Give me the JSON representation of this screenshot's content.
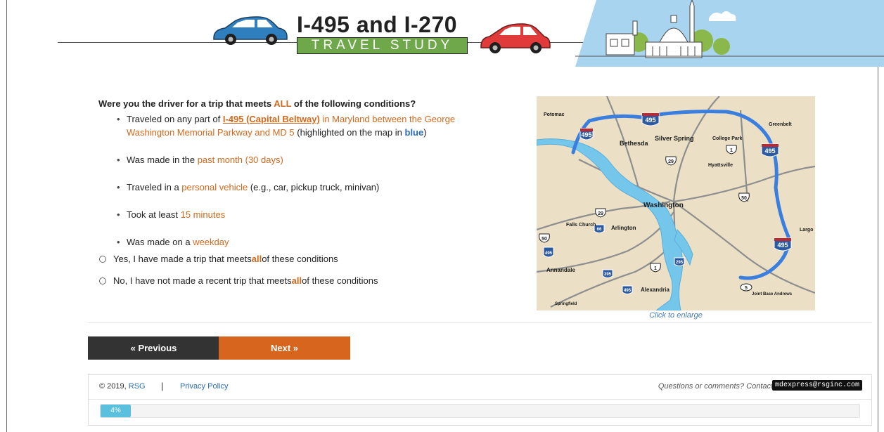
{
  "header": {
    "title": "I-495 and I-270",
    "subtitle": "TRAVEL STUDY",
    "colors": {
      "car_blue": "#2f7fbf",
      "car_red": "#e03a3a",
      "green": "#6fa84a",
      "sky": "#a9d4ef"
    }
  },
  "question": {
    "prefix": "Were you the driver for a trip that meets ",
    "emph": "ALL",
    "suffix": " of the following conditions?"
  },
  "conditions": [
    {
      "a": "Traveled on any part of ",
      "link": "I-495 (Capital Beltway)",
      "b": " in Maryland between the George Washington Memorial Parkway and MD 5",
      "c": " (highlighted on the map in ",
      "d": "blue",
      "e": ")"
    },
    {
      "a": "Was made in the ",
      "hl": "past month (30 days)"
    },
    {
      "a": "Traveled in a ",
      "hl": "personal vehicle",
      "b": " (e.g., car, pickup truck, minivan)"
    },
    {
      "a": "Took at least ",
      "hl": "15 minutes"
    },
    {
      "a": "Was made on a ",
      "hl": "weekday"
    }
  ],
  "options": [
    {
      "a": "Yes, I have made a trip that meets ",
      "hl": "all",
      "b": " of these conditions"
    },
    {
      "a": "No, I have not made a recent trip that meets ",
      "hl": "all",
      "b": " of these conditions"
    }
  ],
  "map": {
    "caption": "Click to enlarge",
    "labels": {
      "potomac": "Potomac",
      "bethesda": "Bethesda",
      "silver_spring": "Silver Spring",
      "college_park": "College Park",
      "greenbelt": "Greenbelt",
      "hyattsville": "Hyattsville",
      "washington": "Washington",
      "falls_church": "Falls Church",
      "arlington": "Arlington",
      "largo": "Largo",
      "annandale": "Annandale",
      "alexandria": "Alexandria",
      "springfield": "Springfield",
      "jba": "Joint Base Andrews"
    },
    "shields": {
      "i495": "495",
      "us29": "29",
      "us50": "50",
      "us1": "1",
      "md5": "5",
      "i66": "66",
      "i395": "395",
      "i295": "295",
      "i95": "495"
    }
  },
  "nav": {
    "previous": "« Previous",
    "next": "Next »"
  },
  "footer": {
    "copyright": "© 2019, ",
    "company": "RSG",
    "separator": "|",
    "privacy": "Privacy Policy",
    "contact": "Questions or comments? Contact us at",
    "email": "mdexpress@rsginc.com"
  },
  "progress": {
    "label": "4%",
    "value": 0.04
  }
}
